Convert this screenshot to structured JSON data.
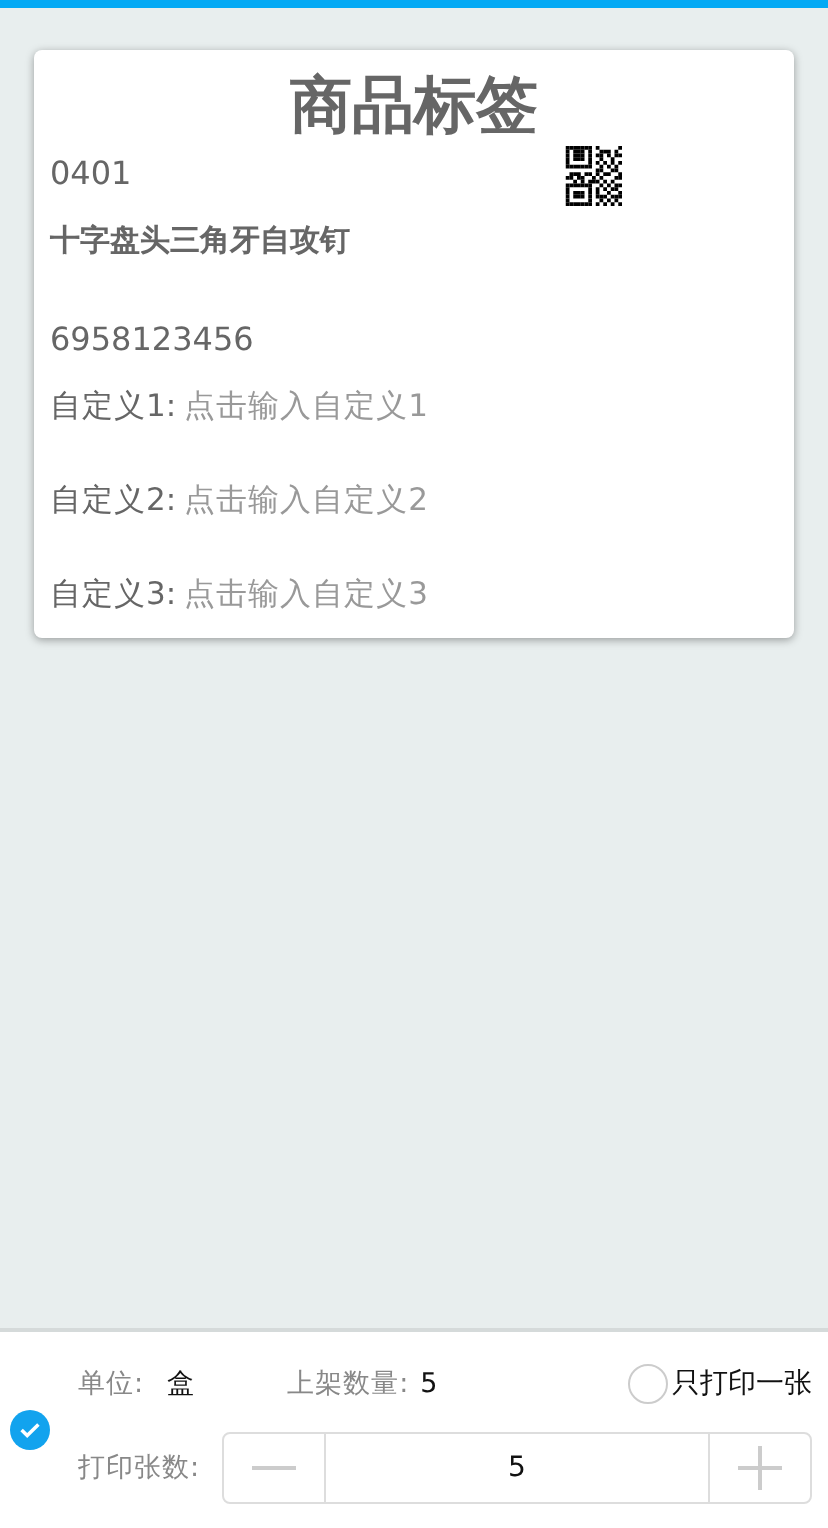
{
  "label": {
    "title": "商品标签",
    "code": "0401",
    "name": "十字盘头三角牙自攻钉",
    "barcode": "6958123456",
    "custom_fields": [
      {
        "label": "自定义1:",
        "placeholder": "点击输入自定义1"
      },
      {
        "label": "自定义2:",
        "placeholder": "点击输入自定义2"
      },
      {
        "label": "自定义3:",
        "placeholder": "点击输入自定义3"
      }
    ]
  },
  "footer": {
    "selected": true,
    "unit_label": "单位:",
    "unit": "盒",
    "shelf_label": "上架数量:",
    "shelf_qty": "5",
    "print_once": {
      "label": "只打印一张",
      "checked": false
    },
    "copies_label": "打印张数:",
    "copies": "5"
  }
}
